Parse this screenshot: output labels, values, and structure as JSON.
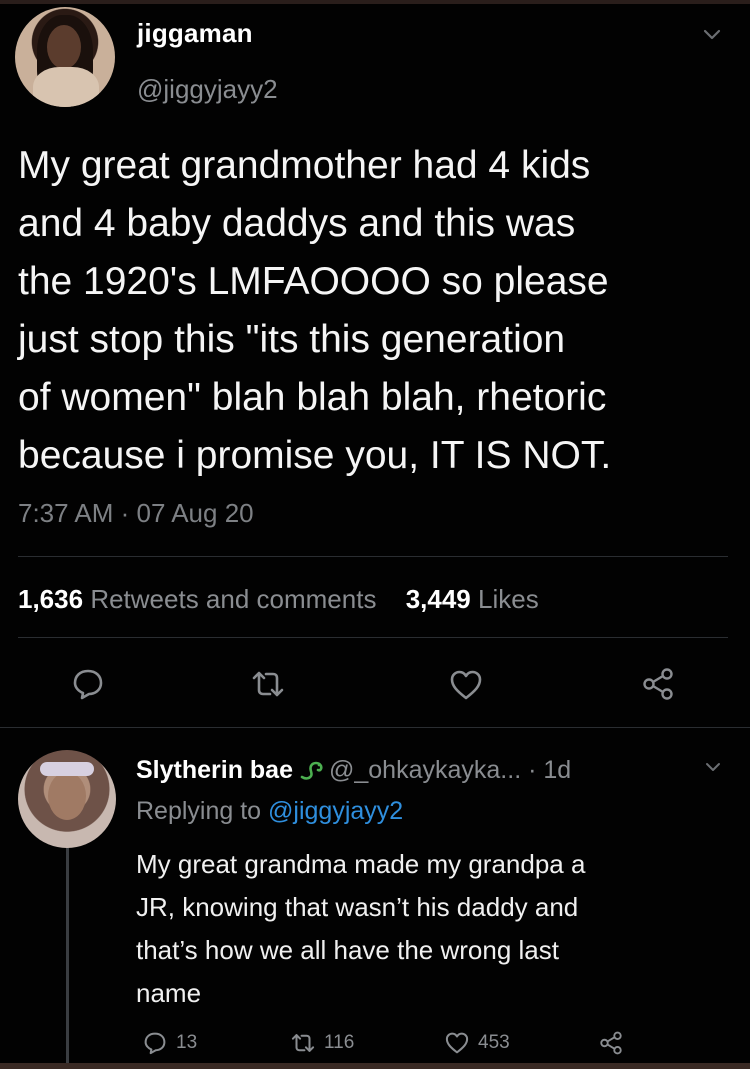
{
  "tweet": {
    "display_name": "jiggaman",
    "handle": "@jiggyjayy2",
    "text": "My great grandmother had 4 kids\nand 4 baby daddys and this was\nthe 1920's LMFAOOOO so please\njust stop this \"its this generation\nof women\" blah blah blah, rhetoric\nbecause i promise you, IT IS NOT.",
    "timestamp": "7:37 AM · 07 Aug 20",
    "retweets_count": "1,636",
    "retweets_label": "Retweets and comments",
    "likes_count": "3,449",
    "likes_label": "Likes",
    "actions": [
      "reply-icon",
      "retweet-icon",
      "like-icon",
      "share-icon"
    ]
  },
  "reply": {
    "display_name": "Slytherin bae",
    "badge_icon": "snake-emoji-icon",
    "handle": "@_ohkaykayka...",
    "time": "· 1d",
    "replying_prefix": "Replying to",
    "replying_mention": "@jiggyjayy2",
    "text": "My great grandma made my grandpa a\nJR, knowing that wasn’t his daddy and\nthat’s how we all have the wrong last\nname",
    "reply_count": "13",
    "retweet_count": "116",
    "like_count": "453"
  },
  "colors": {
    "background": "#000000",
    "text_primary": "#f5f5f5",
    "text_secondary": "#8a8d91",
    "link": "#2f8fde",
    "badge_green": "#4caf50"
  }
}
